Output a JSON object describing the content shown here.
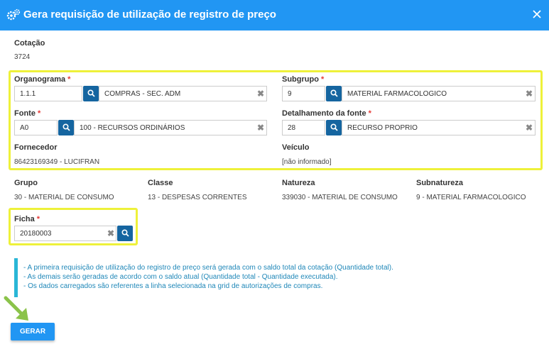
{
  "dialog": {
    "title": "Gera requisição de utilização de registro de preço",
    "close_icon": "close-icon"
  },
  "cotacao": {
    "label": "Cotação",
    "value": "3724"
  },
  "organograma": {
    "label": "Organograma",
    "code": "1.1.1",
    "description": "COMPRAS - SEC. ADM"
  },
  "subgrupo": {
    "label": "Subgrupo",
    "code": "9",
    "description": "MATERIAL FARMACOLOGICO"
  },
  "fonte": {
    "label": "Fonte",
    "code": "A0",
    "description": "100 - RECURSOS ORDINÁRIOS"
  },
  "detalhamento": {
    "label": "Detalhamento da fonte",
    "code": "28",
    "description": "RECURSO PROPRIO"
  },
  "fornecedor": {
    "label": "Fornecedor",
    "value": "86423169349 - LUCIFRAN"
  },
  "veiculo": {
    "label": "Veículo",
    "value": "[não informado]"
  },
  "grupo": {
    "label": "Grupo",
    "value": "30 - MATERIAL DE CONSUMO"
  },
  "classe": {
    "label": "Classe",
    "value": "13 - DESPESAS CORRENTES"
  },
  "natureza": {
    "label": "Natureza",
    "value": "339030 - MATERIAL DE CONSUMO"
  },
  "subnatureza": {
    "label": "Subnatureza",
    "value": "9 - MATERIAL FARMACOLOGICO"
  },
  "ficha": {
    "label": "Ficha",
    "value": "20180003"
  },
  "required_mark": "*",
  "info": {
    "lines": [
      "- A primeira requisição de utilização do registro de preço será gerada com o saldo total da cotação (Quantidade total).",
      "- As demais serão geradas de acordo com o saldo atual (Quantidade total - Quantidade executada).",
      "- Os dados carregados são referentes a linha selecionada na grid de autorizações de compras."
    ]
  },
  "actions": {
    "gerar_label": "GERAR"
  },
  "colors": {
    "header": "#2196f3",
    "search_button": "#1565a0",
    "required": "#e53935",
    "highlight": "#eef13a",
    "info_bar": "#29b6d6",
    "info_text": "#1f87b8",
    "arrow": "#8bc34a"
  }
}
